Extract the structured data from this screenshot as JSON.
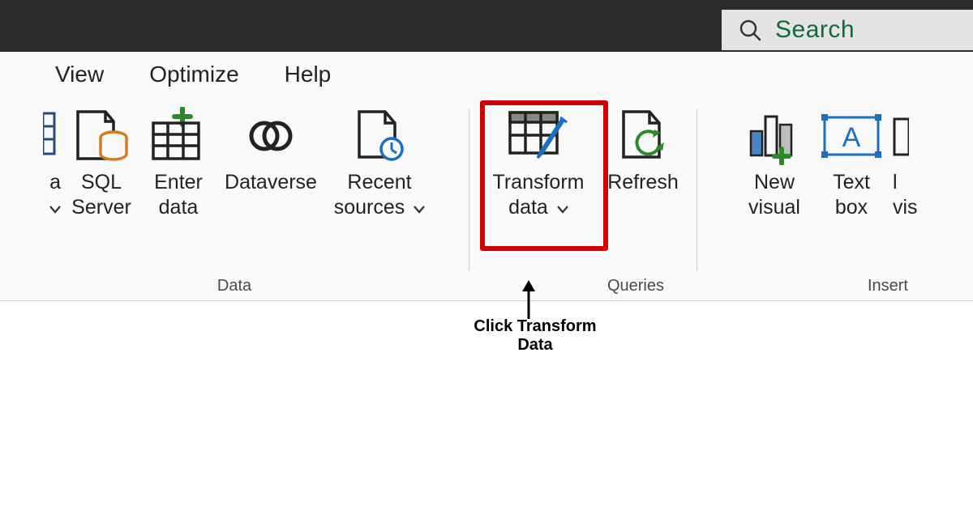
{
  "search": {
    "placeholder": "Search"
  },
  "tabs": {
    "view": "View",
    "optimize": "Optimize",
    "help": "Help"
  },
  "groups": {
    "data": "Data",
    "queries": "Queries",
    "insert": "Insert"
  },
  "buttons": {
    "a_partial": "a",
    "sql1": "SQL",
    "sql2": "Server",
    "enter1": "Enter",
    "enter2": "data",
    "dataverse": "Dataverse",
    "recent1": "Recent",
    "recent2": "sources",
    "transform1": "Transform",
    "transform2": "data",
    "refresh": "Refresh",
    "new1": "New",
    "new2": "visual",
    "text1": "Text",
    "text2": "box",
    "vis_partial": "vis"
  },
  "annotation": {
    "line1": "Click Transform",
    "line2": "Data"
  }
}
